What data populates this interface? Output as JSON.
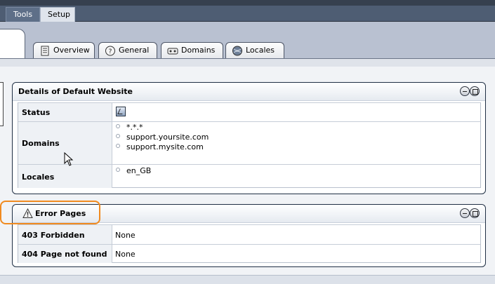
{
  "menu": {
    "items": [
      {
        "label": "Tools"
      },
      {
        "label": "Setup"
      }
    ]
  },
  "tabs": [
    {
      "label": "Overview",
      "icon": "document-icon"
    },
    {
      "label": "General",
      "icon": "help-icon"
    },
    {
      "label": "Domains",
      "icon": "network-icon"
    },
    {
      "label": "Locales",
      "icon": "globe-icon"
    }
  ],
  "details_panel": {
    "title": "Details of Default Website",
    "rows": {
      "status": {
        "label": "Status",
        "value_icon": "checkbox-icon"
      },
      "domains": {
        "label": "Domains",
        "values": [
          "*.*.*",
          "support.yoursite.com",
          "support.mysite.com"
        ]
      },
      "locales": {
        "label": "Locales",
        "values": [
          "en_GB"
        ]
      }
    }
  },
  "errors_panel": {
    "title": "Error Pages",
    "rows": [
      {
        "label": "403 Forbidden",
        "value": "None"
      },
      {
        "label": "404 Page not found",
        "value": "None"
      }
    ]
  },
  "colors": {
    "highlight": "#f08a1f",
    "menubar": "#4e5d73",
    "panel_border": "#1f2f44"
  }
}
